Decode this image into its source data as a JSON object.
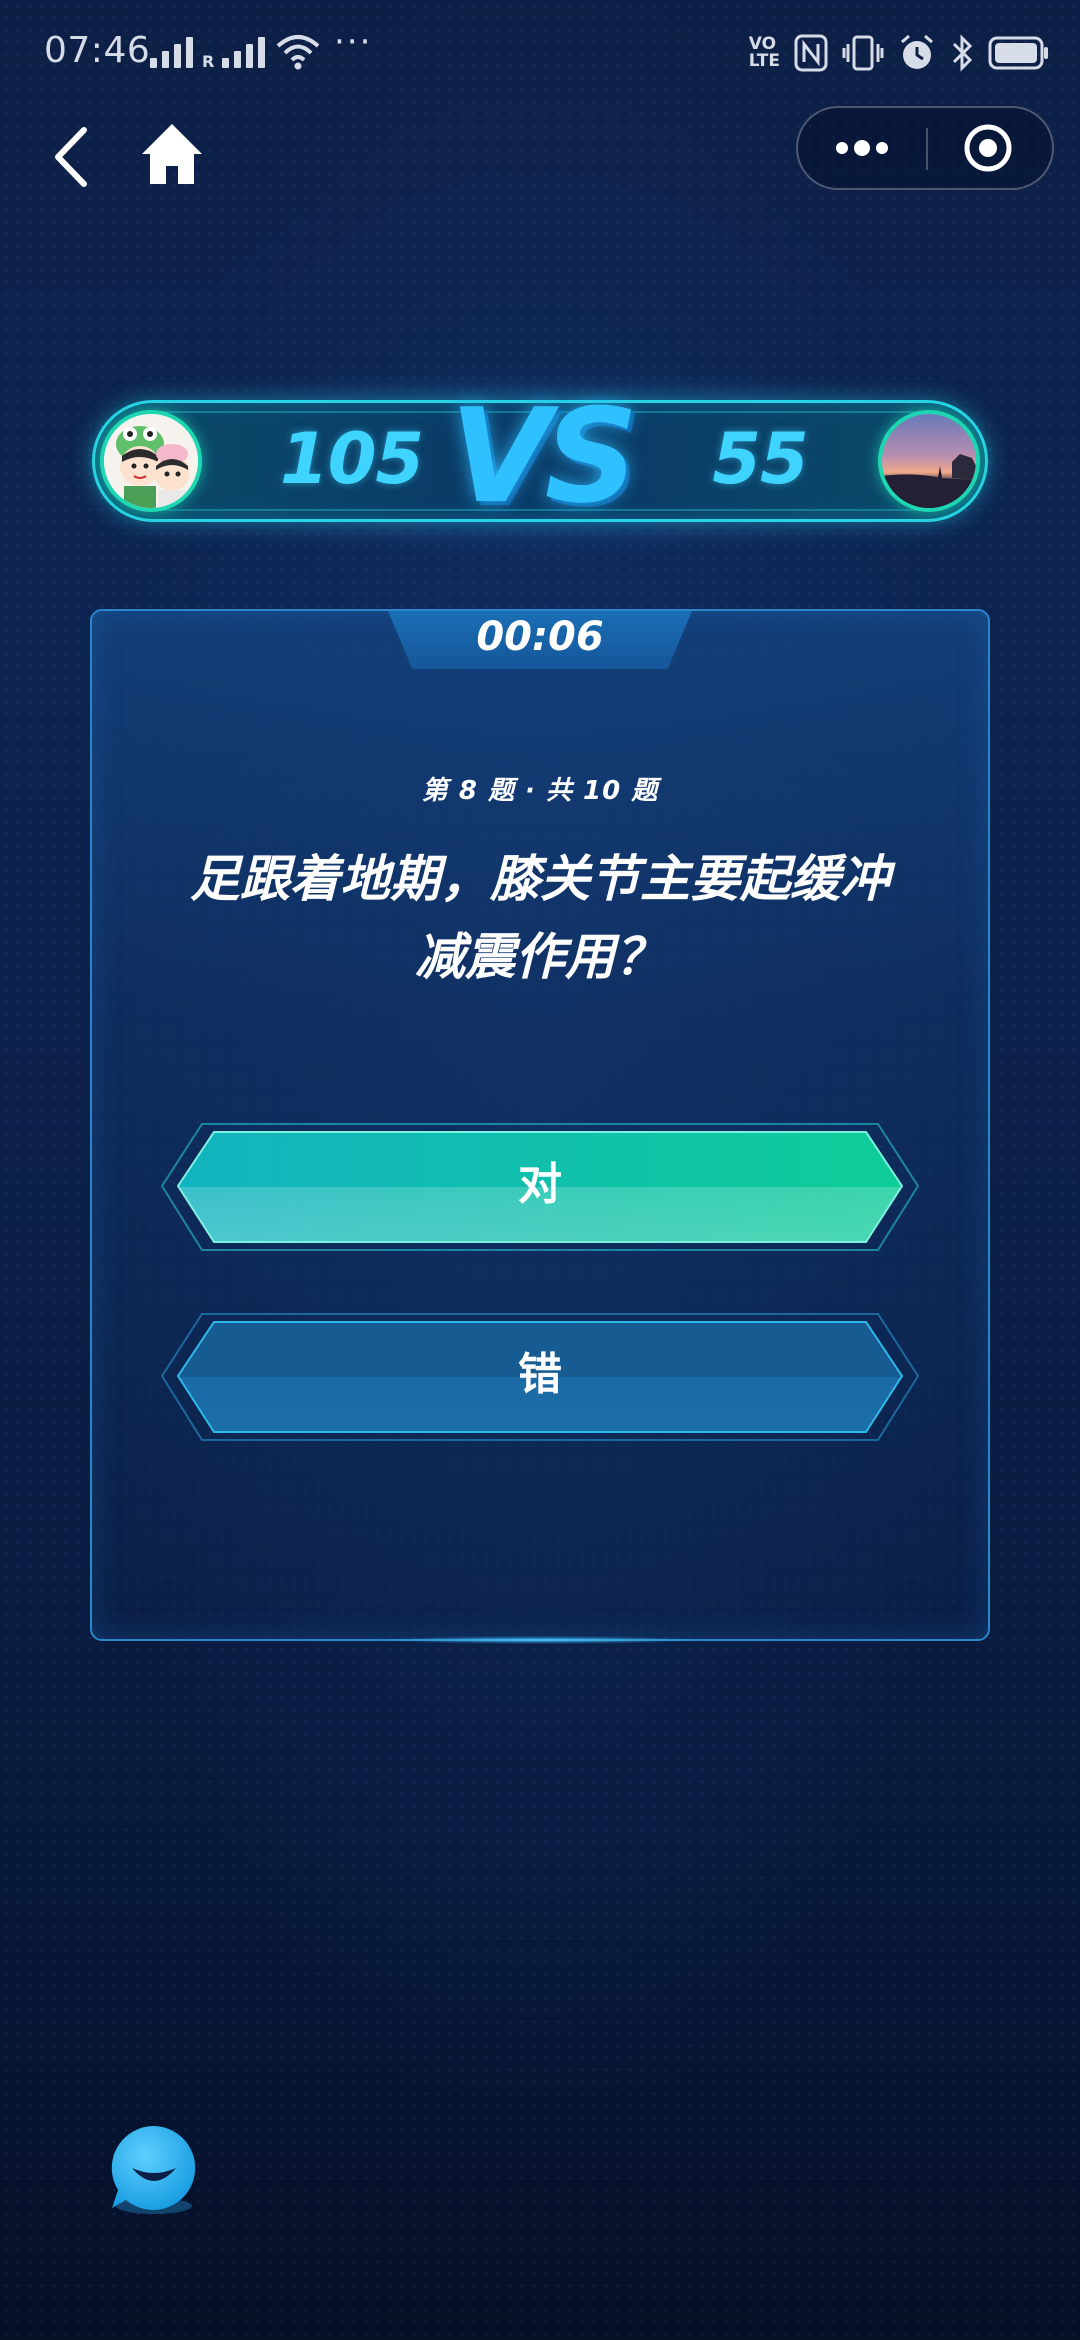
{
  "status_bar": {
    "time": "07:46",
    "roaming_label": "R",
    "more": "···",
    "icons": [
      "signal-icon",
      "signal-roaming-icon",
      "wifi-icon",
      "volte-icon",
      "nfc-icon",
      "vibrate-icon",
      "alarm-icon",
      "bluetooth-icon",
      "battery-icon"
    ],
    "volte_label_top": "VO",
    "volte_label_bottom": "LTE"
  },
  "nav": {
    "icons": [
      "back-icon",
      "home-icon",
      "more-dots-icon",
      "close-target-icon"
    ]
  },
  "versus": {
    "left_score": "105",
    "vs_label": "VS",
    "right_score": "55"
  },
  "question": {
    "timer": "00:06",
    "progress": "第 8 题 · 共 10 题",
    "text": "足跟着地期，膝关节主要起缓冲减震作用？"
  },
  "answers": [
    {
      "label": "对",
      "state": "highlighted"
    },
    {
      "label": "错",
      "state": "normal"
    }
  ],
  "colors": {
    "accent_cyan": "#27d3e6",
    "score_blue": "#3fd4ff",
    "true_button": "#14c7a0",
    "false_button": "#1a5f97",
    "background": "#0d2452"
  },
  "chat": {
    "icon": "chat-bubble-icon"
  }
}
